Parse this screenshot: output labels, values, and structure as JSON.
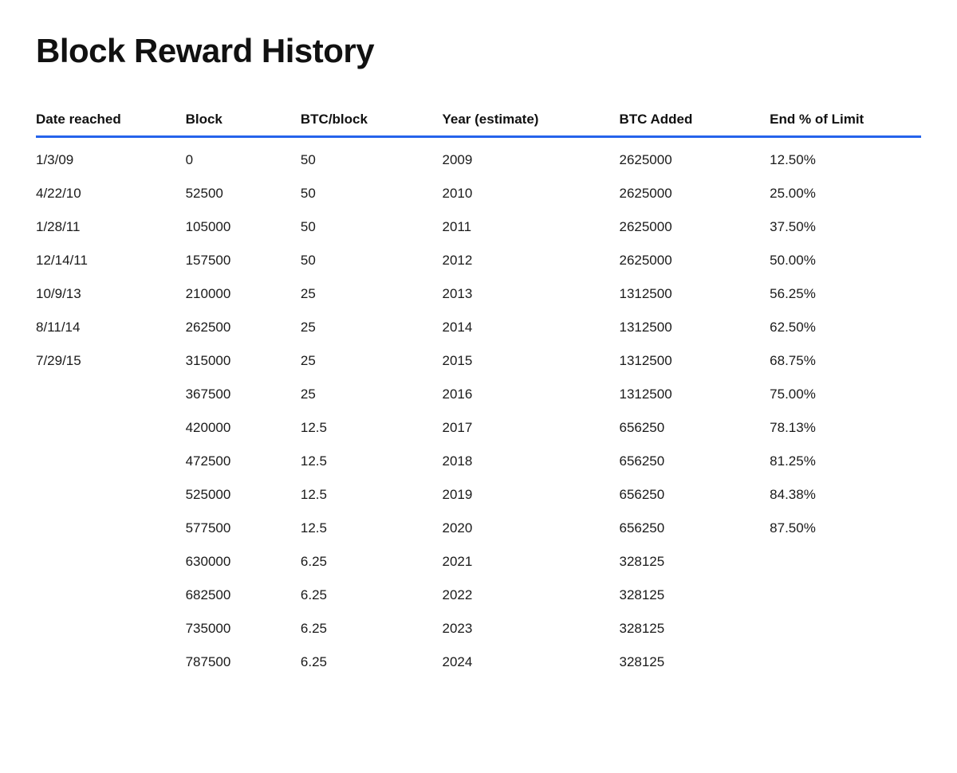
{
  "title": "Block Reward History",
  "columns": [
    {
      "key": "date",
      "label": "Date reached"
    },
    {
      "key": "block",
      "label": "Block"
    },
    {
      "key": "btcblock",
      "label": "BTC/block"
    },
    {
      "key": "year",
      "label": "Year (estimate)"
    },
    {
      "key": "btcadded",
      "label": "BTC Added"
    },
    {
      "key": "endlimit",
      "label": "End % of Limit"
    }
  ],
  "rows": [
    {
      "date": "1/3/09",
      "block": "0",
      "btcblock": "50",
      "year": "2009",
      "btcadded": "2625000",
      "endlimit": "12.50%"
    },
    {
      "date": "4/22/10",
      "block": "52500",
      "btcblock": "50",
      "year": "2010",
      "btcadded": "2625000",
      "endlimit": "25.00%"
    },
    {
      "date": "1/28/11",
      "block": "105000",
      "btcblock": "50",
      "year": "2011",
      "btcadded": "2625000",
      "endlimit": "37.50%"
    },
    {
      "date": "12/14/11",
      "block": "157500",
      "btcblock": "50",
      "year": "2012",
      "btcadded": "2625000",
      "endlimit": "50.00%"
    },
    {
      "date": "10/9/13",
      "block": "210000",
      "btcblock": "25",
      "year": "2013",
      "btcadded": "1312500",
      "endlimit": "56.25%"
    },
    {
      "date": "8/11/14",
      "block": "262500",
      "btcblock": "25",
      "year": "2014",
      "btcadded": "1312500",
      "endlimit": "62.50%"
    },
    {
      "date": "7/29/15",
      "block": "315000",
      "btcblock": "25",
      "year": "2015",
      "btcadded": "1312500",
      "endlimit": "68.75%"
    },
    {
      "date": "",
      "block": "367500",
      "btcblock": "25",
      "year": "2016",
      "btcadded": "1312500",
      "endlimit": "75.00%"
    },
    {
      "date": "",
      "block": "420000",
      "btcblock": "12.5",
      "year": "2017",
      "btcadded": "656250",
      "endlimit": "78.13%"
    },
    {
      "date": "",
      "block": "472500",
      "btcblock": "12.5",
      "year": "2018",
      "btcadded": "656250",
      "endlimit": "81.25%"
    },
    {
      "date": "",
      "block": "525000",
      "btcblock": "12.5",
      "year": "2019",
      "btcadded": "656250",
      "endlimit": "84.38%"
    },
    {
      "date": "",
      "block": "577500",
      "btcblock": "12.5",
      "year": "2020",
      "btcadded": "656250",
      "endlimit": "87.50%"
    },
    {
      "date": "",
      "block": "630000",
      "btcblock": "6.25",
      "year": "2021",
      "btcadded": "328125",
      "endlimit": ""
    },
    {
      "date": "",
      "block": "682500",
      "btcblock": "6.25",
      "year": "2022",
      "btcadded": "328125",
      "endlimit": ""
    },
    {
      "date": "",
      "block": "735000",
      "btcblock": "6.25",
      "year": "2023",
      "btcadded": "328125",
      "endlimit": ""
    },
    {
      "date": "",
      "block": "787500",
      "btcblock": "6.25",
      "year": "2024",
      "btcadded": "328125",
      "endlimit": ""
    }
  ]
}
